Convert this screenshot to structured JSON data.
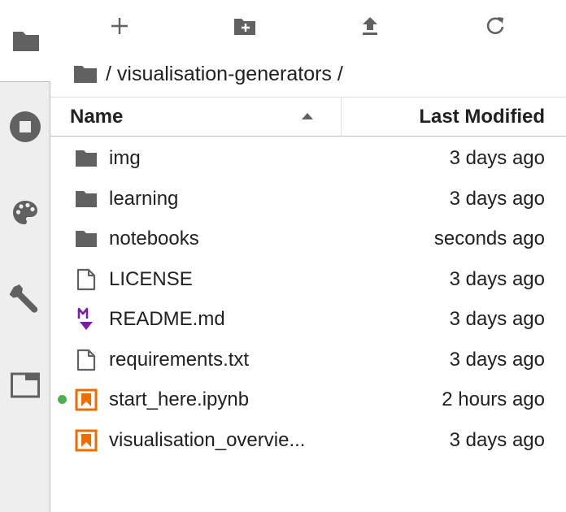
{
  "sidebar": {
    "tabs": [
      {
        "name": "file-browser",
        "icon": "folder-icon",
        "active": true
      },
      {
        "name": "running",
        "icon": "stop-circle-icon",
        "active": false
      },
      {
        "name": "commands",
        "icon": "palette-icon",
        "active": false
      },
      {
        "name": "property-inspector",
        "icon": "wrench-icon",
        "active": false
      },
      {
        "name": "open-tabs",
        "icon": "window-tab-icon",
        "active": false
      }
    ]
  },
  "toolbar": {
    "buttons": [
      {
        "name": "new-launcher",
        "icon": "plus-icon"
      },
      {
        "name": "new-folder",
        "icon": "new-folder-icon"
      },
      {
        "name": "upload",
        "icon": "upload-icon"
      },
      {
        "name": "refresh",
        "icon": "refresh-icon"
      }
    ]
  },
  "breadcrumbs": {
    "path": "/ visualisation-generators /"
  },
  "header": {
    "name_label": "Name",
    "modified_label": "Last Modified",
    "sort": "ascending"
  },
  "files": [
    {
      "name": "img",
      "modified": "3 days ago",
      "type": "folder",
      "icon": "folder-icon"
    },
    {
      "name": "learning",
      "modified": "3 days ago",
      "type": "folder",
      "icon": "folder-icon"
    },
    {
      "name": "notebooks",
      "modified": "seconds ago",
      "type": "folder",
      "icon": "folder-icon"
    },
    {
      "name": "LICENSE",
      "modified": "3 days ago",
      "type": "file",
      "icon": "file-icon"
    },
    {
      "name": "README.md",
      "modified": "3 days ago",
      "type": "markdown",
      "icon": "markdown-icon"
    },
    {
      "name": "requirements.txt",
      "modified": "3 days ago",
      "type": "file",
      "icon": "file-icon"
    },
    {
      "name": "start_here.ipynb",
      "modified": "2 hours ago",
      "type": "notebook",
      "icon": "notebook-icon",
      "running": true
    },
    {
      "name": "visualisation_overvie...",
      "modified": "3 days ago",
      "type": "notebook",
      "icon": "notebook-icon"
    }
  ],
  "colors": {
    "folder": "#616161",
    "notebook": "#ef6c00",
    "markdown": "#7b1fa2",
    "running": "#4caf50",
    "sidebar_bg": "#eeeeee"
  }
}
